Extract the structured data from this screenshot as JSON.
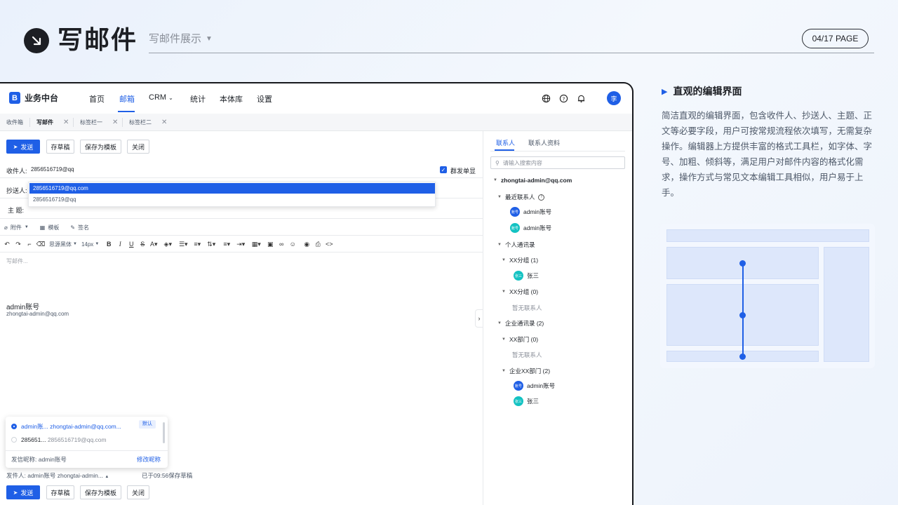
{
  "slide": {
    "title": "写邮件",
    "subtitle": "写邮件展示",
    "page": "04/17 PAGE"
  },
  "app": {
    "logo": "业务中台",
    "nav": [
      "首页",
      "邮箱",
      "CRM",
      "统计",
      "本体库",
      "设置"
    ],
    "avatar": "李",
    "tabs": [
      "收件箱",
      "写邮件",
      "标签栏一",
      "标签栏二"
    ],
    "toolbar": {
      "send": "发送",
      "draft": "存草稿",
      "template": "保存为模板",
      "close": "关闭"
    },
    "fields": {
      "to_label": "收件人:",
      "to_value": "2856516719@qq",
      "cc_label": "抄送人:",
      "subject_label": "主  题:",
      "mass_send": "群发单显"
    },
    "suggestions": [
      "2856516719@qq.com",
      "2856516719@qq"
    ],
    "attach_bar": {
      "attach": "附件",
      "template": "模板",
      "signature": "签名"
    },
    "format_bar": {
      "font": "思源黑体",
      "size": "14px"
    },
    "editor": {
      "placeholder": "写邮件...",
      "signature_name": "admin账号",
      "signature_email": "zhongtai-admin@qq.com"
    },
    "sender_popup": {
      "item1_name": "admin账...",
      "item1_email": "zhongtai-admin@qq.com...",
      "item1_badge": "默认",
      "item2_name": "285651...",
      "item2_email": "2856516719@qq.com",
      "nickname_label": "发信昵称: admin账号",
      "edit_nickname": "修改昵称"
    },
    "footer": {
      "sender": "发件人: admin账号 zhongtai-admin...",
      "saved": "已于09:56保存草稿"
    },
    "contacts": {
      "tabs": [
        "联系人",
        "联系人资料"
      ],
      "search_placeholder": "请输入搜索内容",
      "root": "zhongtai-admin@qq.com",
      "recent": "最近联系人",
      "recent_items": [
        {
          "av": "账号",
          "name": "admin账号"
        },
        {
          "av": "账号",
          "name": "admin账号"
        }
      ],
      "personal": "个人通讯录",
      "group1": "XX分组 (1)",
      "group1_item": {
        "av": "张三",
        "name": "张三"
      },
      "group2": "XX分组 (0)",
      "empty1": "暂无联系人",
      "enterprise": "企业通讯录 (2)",
      "dept1": "XX部门 (0)",
      "empty2": "暂无联系人",
      "dept2": "企业XX部门 (2)",
      "dept2_items": [
        {
          "av": "账号",
          "name": "admin账号"
        },
        {
          "av": "张三",
          "name": "张三"
        }
      ]
    }
  },
  "description": {
    "title": "直观的编辑界面",
    "body": "简洁直观的编辑界面，包含收件人、抄送人、主题、正文等必要字段，用户可按常规流程依次填写，无需复杂操作。编辑器上方提供丰富的格式工具栏，如字体、字号、加粗、倾斜等，满足用户对邮件内容的格式化需求，操作方式与常见文本编辑工具相似，用户易于上手。"
  },
  "colors": {
    "accent": "#1f5fe6",
    "teal": "#13c2c2",
    "dark": "#1d1f24"
  }
}
